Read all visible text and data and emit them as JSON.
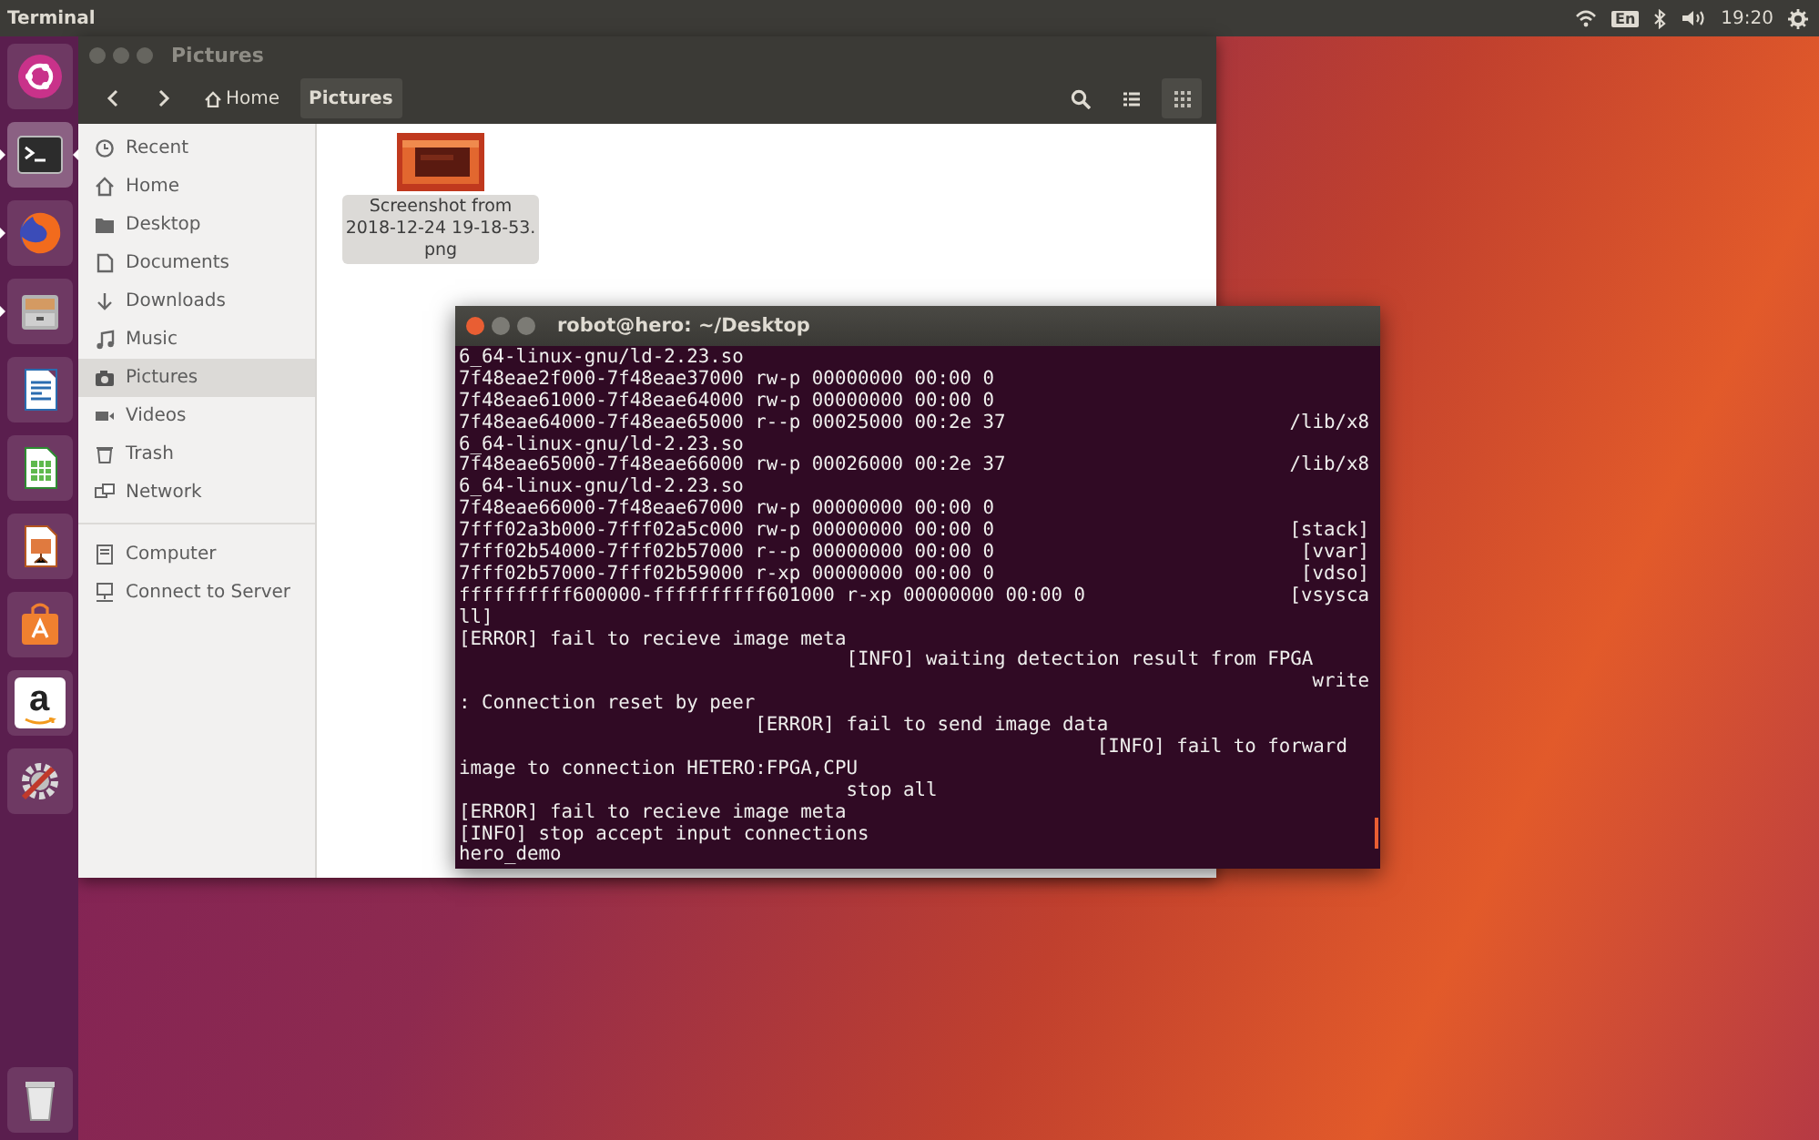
{
  "top_bar": {
    "app_title": "Terminal",
    "keyboard": "En",
    "clock": "19:20"
  },
  "launcher": [
    {
      "kind": "dash",
      "running": false,
      "focused": false
    },
    {
      "kind": "terminal",
      "running": true,
      "focused": true
    },
    {
      "kind": "browser",
      "running": true,
      "focused": false
    },
    {
      "kind": "files",
      "running": true,
      "focused": false
    },
    {
      "kind": "writer",
      "running": false,
      "focused": false
    },
    {
      "kind": "calc",
      "running": false,
      "focused": false
    },
    {
      "kind": "impress",
      "running": false,
      "focused": false
    },
    {
      "kind": "store",
      "running": false,
      "focused": false
    },
    {
      "kind": "amazon",
      "running": false,
      "focused": false,
      "glyph": "a"
    },
    {
      "kind": "settings",
      "running": false,
      "focused": false
    },
    {
      "kind": "trash",
      "running": false,
      "focused": false
    }
  ],
  "files_window": {
    "title": "Pictures",
    "path": [
      {
        "label": "Home",
        "kind": "home",
        "selected": false
      },
      {
        "label": "Pictures",
        "kind": "folder",
        "selected": true
      }
    ],
    "views": [
      {
        "kind": "list",
        "selected": false
      },
      {
        "kind": "grid",
        "selected": true
      }
    ],
    "sidebar": {
      "places": [
        {
          "label": "Recent",
          "kind": "recent",
          "selected": false
        },
        {
          "label": "Home",
          "kind": "home",
          "selected": false
        },
        {
          "label": "Desktop",
          "kind": "folder",
          "selected": false
        },
        {
          "label": "Documents",
          "kind": "document",
          "selected": false
        },
        {
          "label": "Downloads",
          "kind": "download",
          "selected": false
        },
        {
          "label": "Music",
          "kind": "music",
          "selected": false
        },
        {
          "label": "Pictures",
          "kind": "camera",
          "selected": true
        },
        {
          "label": "Videos",
          "kind": "video",
          "selected": false
        },
        {
          "label": "Trash",
          "kind": "trash",
          "selected": false
        },
        {
          "label": "Network",
          "kind": "network",
          "selected": false
        }
      ],
      "devices": [
        {
          "label": "Computer",
          "kind": "computer",
          "selected": false
        },
        {
          "label": "Connect to Server",
          "kind": "server",
          "selected": false
        }
      ]
    },
    "files": [
      {
        "name_lines": [
          "Screenshot from",
          "2018-12-24 19-18-53.",
          "png"
        ],
        "kind": "picture",
        "selected": true
      }
    ]
  },
  "terminal_window": {
    "title": "robot@hero: ~/Desktop",
    "lines": [
      {
        "text": "6_64-linux-gnu/ld-2.23.so"
      },
      {
        "text": "7f48eae2f000-7f48eae37000 rw-p 00000000 00:00 0"
      },
      {
        "text": "7f48eae61000-7f48eae64000 rw-p 00000000 00:00 0"
      },
      {
        "text": "7f48eae64000-7f48eae65000 r--p 00025000 00:2e 37",
        "tail": "/lib/x8"
      },
      {
        "text": "6_64-linux-gnu/ld-2.23.so"
      },
      {
        "text": "7f48eae65000-7f48eae66000 rw-p 00026000 00:2e 37",
        "tail": "/lib/x8"
      },
      {
        "text": "6_64-linux-gnu/ld-2.23.so"
      },
      {
        "text": "7f48eae66000-7f48eae67000 rw-p 00000000 00:00 0"
      },
      {
        "text": "7fff02a3b000-7fff02a5c000 rw-p 00000000 00:00 0",
        "tail": "[stack]"
      },
      {
        "text": "7fff02b54000-7fff02b57000 r--p 00000000 00:00 0",
        "tail": "[vvar]"
      },
      {
        "text": "7fff02b57000-7fff02b59000 r-xp 00000000 00:00 0",
        "tail": "[vdso]"
      },
      {
        "text": "ffffffffff600000-ffffffffff601000 r-xp 00000000 00:00 0",
        "tail": "[vsysca"
      },
      {
        "text": "ll]"
      },
      {
        "text": "[ERROR] fail to recieve image meta"
      },
      {
        "text": "                                  [INFO] waiting detection result from FPGA"
      },
      {
        "tail": "write"
      },
      {
        "text": ": Connection reset by peer"
      },
      {
        "text": "                          [ERROR] fail to send image data"
      },
      {
        "text": "                                                        [INFO] fail to forward"
      },
      {
        "text": "image to connection HETERO:FPGA,CPU"
      },
      {
        "text": "                                  stop all"
      },
      {
        "text": "[ERROR] fail to recieve image meta"
      },
      {
        "text": "[INFO] stop accept input connections"
      },
      {
        "text": "hero_demo"
      }
    ]
  }
}
